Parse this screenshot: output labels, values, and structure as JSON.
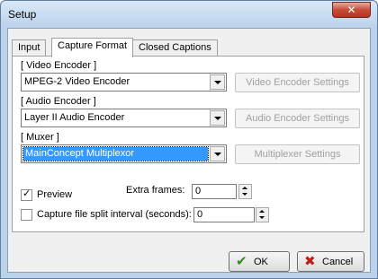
{
  "window": {
    "title": "Setup",
    "close_symbol": "✕",
    "close_icon": "close-icon"
  },
  "tabs": [
    {
      "label": "Input",
      "active": false
    },
    {
      "label": "Capture Format",
      "active": true
    },
    {
      "label": "Closed Captions",
      "active": false
    }
  ],
  "video": {
    "group_label": "[ Video Encoder ]",
    "value": "MPEG-2 Video Encoder",
    "settings_label": "Video Encoder Settings"
  },
  "audio": {
    "group_label": "[ Audio Encoder ]",
    "value": "Layer II Audio Encoder",
    "settings_label": "Audio Encoder Settings"
  },
  "muxer": {
    "group_label": "[ Muxer ]",
    "value": "MainConcept Multiplexor",
    "settings_label": "Multiplexer Settings"
  },
  "preview": {
    "label": "Preview",
    "checked": true
  },
  "extra_frames": {
    "label": "Extra frames:",
    "value": "0"
  },
  "split": {
    "label": "Capture file split interval (seconds):",
    "checked": false,
    "value": "0"
  },
  "footer": {
    "ok_label": "OK",
    "ok_icon": "checkmark-icon",
    "ok_color": "#2e8b1e",
    "cancel_label": "Cancel",
    "cancel_icon": "cross-icon",
    "cancel_color": "#c0201a"
  }
}
